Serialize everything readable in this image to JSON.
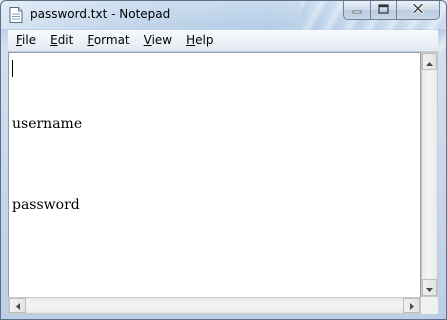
{
  "window": {
    "title": "password.txt - Notepad",
    "icon": "notepad-document-icon"
  },
  "caption_buttons": {
    "minimize_icon": "minimize-icon",
    "maximize_icon": "maximize-icon",
    "close_icon": "close-icon"
  },
  "menu": {
    "items": [
      {
        "label": "File",
        "accel": "F",
        "rest": "ile"
      },
      {
        "label": "Edit",
        "accel": "E",
        "rest": "dit"
      },
      {
        "label": "Format",
        "accel": "F",
        "rest": "ormat",
        "accel_index": 0
      },
      {
        "label": "View",
        "accel": "V",
        "rest": "iew"
      },
      {
        "label": "Help",
        "accel": "H",
        "rest": "elp"
      }
    ]
  },
  "document": {
    "lines": [
      "username",
      "password"
    ]
  },
  "colors": {
    "editor_background": "#ffffff",
    "window_frame": "#bccfe6",
    "menu_background": "#eef2f8"
  }
}
